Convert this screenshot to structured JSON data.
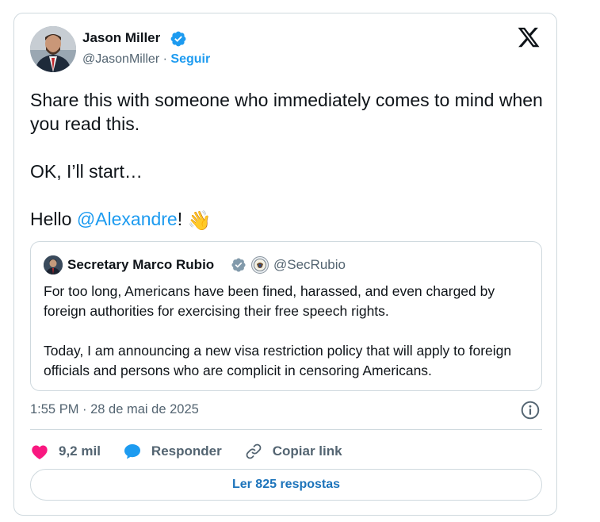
{
  "author": {
    "name": "Jason Miller",
    "handle": "@JasonMiller",
    "separator": "·",
    "follow_label": "Seguir"
  },
  "tweet": {
    "lines": [
      "Share this with someone who immediately comes to mind when you read this.",
      "OK, I’ll start…"
    ],
    "hello_prefix": "Hello ",
    "mention": "@Alexandre",
    "hello_suffix": "!",
    "emoji": "👋"
  },
  "quote": {
    "name": "Secretary Marco Rubio",
    "handle": "@SecRubio",
    "paragraphs": [
      "For too long, Americans have been fined, harassed, and even charged by foreign authorities for exercising their free speech rights.",
      "Today, I am announcing a new visa restriction policy that will apply to foreign officials and persons who are complicit in censoring Americans."
    ]
  },
  "timestamp": "1:55 PM · 28 de mai de 2025",
  "actions": {
    "likes": "9,2 mil",
    "reply_label": "Responder",
    "copy_label": "Copiar link"
  },
  "replies_button": "Ler 825 respostas",
  "colors": {
    "accent": "#1d9bf0",
    "like": "#f91880",
    "muted": "#536471",
    "border": "#cfd9de"
  },
  "icons": [
    "verified-badge-icon",
    "x-logo-icon",
    "gov-seal-icon",
    "info-icon",
    "heart-icon",
    "reply-bubble-icon",
    "link-icon"
  ]
}
